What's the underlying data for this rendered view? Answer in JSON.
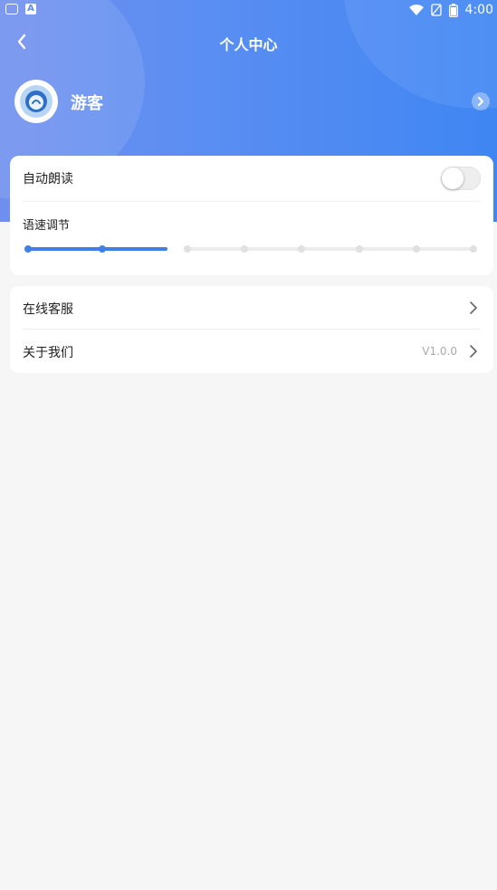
{
  "status_bar": {
    "time": "4:00",
    "left_icons": [
      "notification-icon",
      "a-badge-icon"
    ],
    "right_icons": [
      "wifi-icon",
      "no-sim-icon",
      "battery-icon"
    ],
    "a_badge": "A"
  },
  "header": {
    "title": "个人中心"
  },
  "profile": {
    "name": "游客"
  },
  "settings": {
    "auto_read": {
      "label": "自动朗读",
      "enabled": false
    },
    "speech_rate": {
      "label": "语速调节",
      "level": 2,
      "steps": 8
    }
  },
  "menu": {
    "online_service": {
      "label": "在线客服"
    },
    "about": {
      "label": "关于我们",
      "version": "V1.0.0"
    }
  },
  "colors": {
    "accent": "#3f80e4",
    "header_start": "#6f8fee",
    "header_end": "#3f86f3",
    "background": "#f6f6f6"
  }
}
